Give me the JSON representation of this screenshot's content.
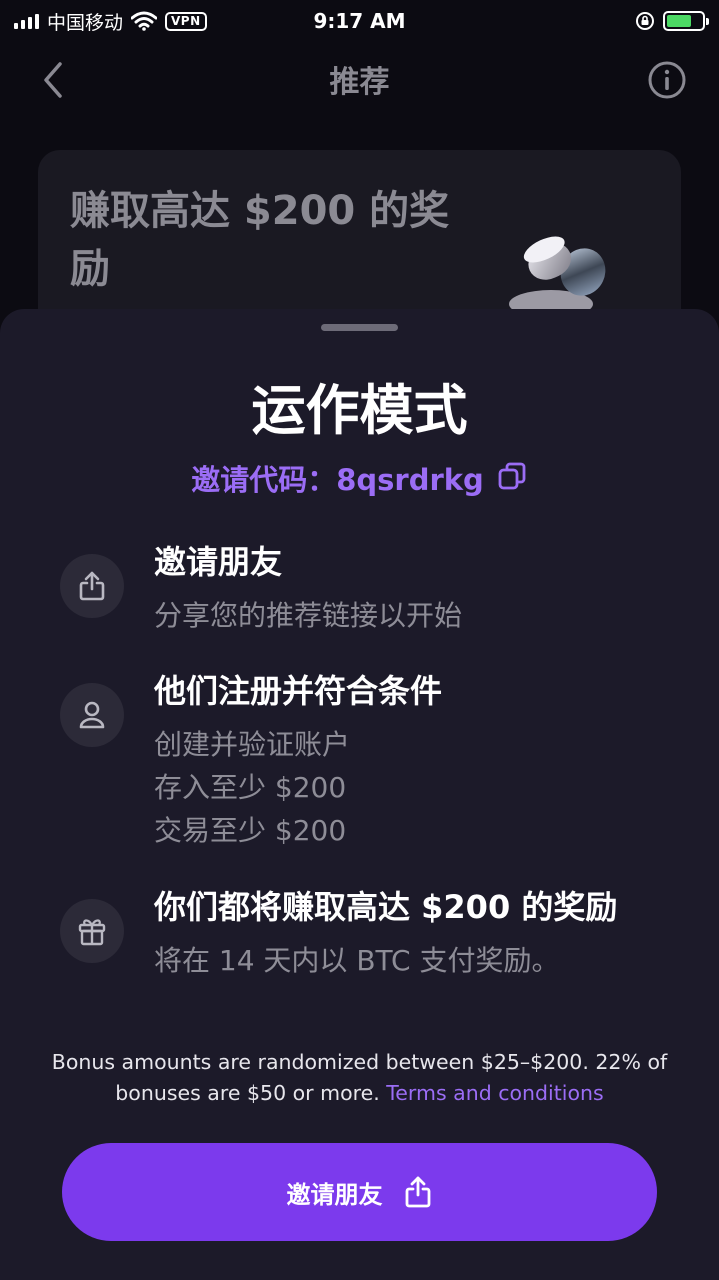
{
  "status_bar": {
    "carrier": "中国移动",
    "vpn": "VPN",
    "time": "9:17 AM"
  },
  "nav": {
    "title": "推荐"
  },
  "promo": {
    "title": "赚取高达 $200 的奖励"
  },
  "sheet": {
    "title": "运作模式",
    "invite_code_label": "邀请代码：",
    "invite_code": "8qsrdrkg",
    "steps": [
      {
        "icon": "share-icon",
        "title": "邀请朋友",
        "lines": [
          "分享您的推荐链接以开始"
        ]
      },
      {
        "icon": "person-icon",
        "title": "他们注册并符合条件",
        "lines": [
          "创建并验证账户",
          "存入至少 $200",
          "交易至少 $200"
        ]
      },
      {
        "icon": "gift-icon",
        "title": "你们都将赚取高达 $200 的奖励",
        "lines": [
          "将在 14 天内以 BTC 支付奖励。"
        ]
      }
    ],
    "disclaimer": "Bonus amounts are randomized between $25–$200. 22% of bonuses are $50 or more.",
    "terms_link": "Terms and conditions",
    "cta_label": "邀请朋友"
  },
  "colors": {
    "accent": "#7c3aed",
    "accent_text": "#9b6df5",
    "sheet_bg": "#1c1a29",
    "page_bg": "#0c0b12"
  }
}
